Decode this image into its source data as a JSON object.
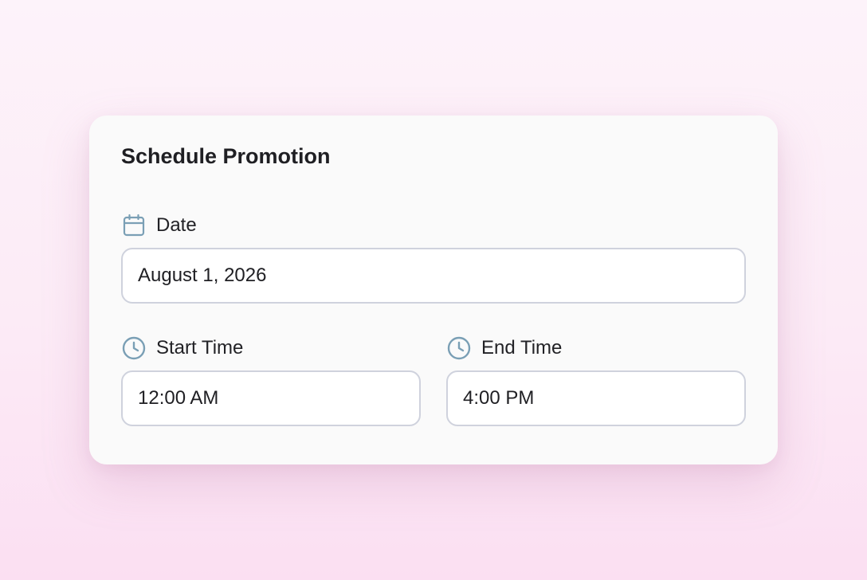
{
  "dialog": {
    "title": "Schedule Promotion"
  },
  "date": {
    "label": "Date",
    "value": "August 1, 2026",
    "icon": "calendar-icon"
  },
  "start_time": {
    "label": "Start Time",
    "value": "12:00 AM",
    "icon": "clock-icon"
  },
  "end_time": {
    "label": "End Time",
    "value": "4:00 PM",
    "icon": "clock-icon"
  },
  "colors": {
    "icon": "#7a9fb5",
    "field_border": "#cfd2dd",
    "card_background": "#fafafa",
    "page_background": "#fcebf6"
  }
}
